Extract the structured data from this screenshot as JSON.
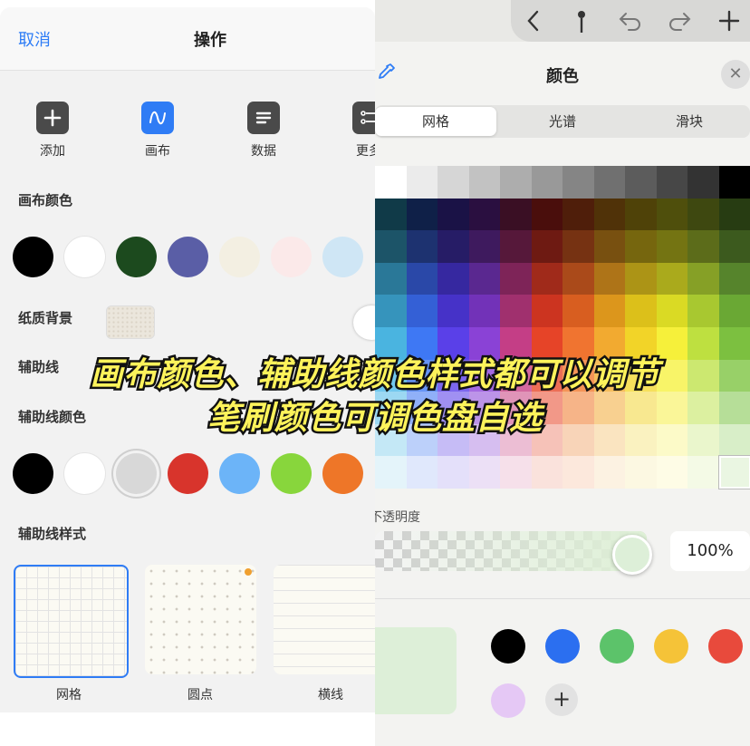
{
  "left_panel": {
    "cancel": "取消",
    "title": "操作",
    "tools": [
      {
        "label": "添加",
        "icon": "plus-icon"
      },
      {
        "label": "画布",
        "icon": "canvas-wave-icon"
      },
      {
        "label": "数据",
        "icon": "data-lines-icon"
      },
      {
        "label": "更多",
        "icon": "more-icon"
      }
    ],
    "canvas_color_title": "画布颜色",
    "canvas_colors": [
      "#000000",
      "#ffffff",
      "#1c4a1e",
      "#5a5ea6",
      "#f3efe2",
      "#fbe9e9",
      "#cfe6f5"
    ],
    "paper_bg_label": "纸质背景",
    "guide_label": "辅助线",
    "guide_color_title": "辅助线颜色",
    "guide_colors": [
      "#000000",
      "#ffffff",
      "#d8d8d8",
      "#d8342c",
      "#6cb4f8",
      "#88d63c",
      "#ee7628"
    ],
    "guide_style_title": "辅助线样式",
    "styles": [
      "网格",
      "圆点",
      "横线"
    ]
  },
  "right_panel": {
    "top_icons": [
      "back-chevron-icon",
      "pin-icon",
      "undo-icon",
      "redo-icon",
      "plus-icon"
    ],
    "title": "颜色",
    "close": "✕",
    "tabs": [
      "网格",
      "光谱",
      "滑块"
    ],
    "active_tab": 0,
    "opacity_label": "不透明度",
    "opacity_value": "100%",
    "opacity_fraction": 1.0,
    "current_color": "#ddefd8",
    "recent_colors": [
      "#000000",
      "#2b6ff0",
      "#5cc36a",
      "#f5c338",
      "#e84a3c",
      "#e5c8f5"
    ],
    "add_label": "+"
  },
  "caption": {
    "line1": "画布颜色、辅助线颜色样式都可以调节",
    "line2": "笔刷颜色可调色盘自选"
  },
  "palette": {
    "rows": [
      [
        "#ffffff",
        "#ebebeb",
        "#d6d6d6",
        "#c2c2c2",
        "#adadad",
        "#999999",
        "#858585",
        "#707070",
        "#5c5c5c",
        "#474747",
        "#333333",
        "#000000"
      ],
      [
        "#103a48",
        "#0f2048",
        "#1a1246",
        "#2a0f40",
        "#3a0f24",
        "#4a0e0c",
        "#4f1e0a",
        "#503208",
        "#4f4208",
        "#4f4f0c",
        "#3e4810",
        "#273c12"
      ],
      [
        "#1c5468",
        "#1d3270",
        "#261c66",
        "#3e1a5e",
        "#56183a",
        "#6e1a12",
        "#763212",
        "#785010",
        "#76660e",
        "#747412",
        "#5c6c1a",
        "#3c5a1e"
      ],
      [
        "#2a7898",
        "#2a48a8",
        "#3628a0",
        "#5a2890",
        "#7e2458",
        "#a02a1a",
        "#aa4a1a",
        "#ae7418",
        "#ac9416",
        "#aaaa1c",
        "#86a026",
        "#56842c"
      ],
      [
        "#3694bc",
        "#3460d6",
        "#4632c8",
        "#7232b8",
        "#a0306e",
        "#cc3420",
        "#d85e20",
        "#dc961c",
        "#dcc01a",
        "#dada24",
        "#a8c830",
        "#6aa834"
      ],
      [
        "#4ab4e0",
        "#3e78f4",
        "#5a40e8",
        "#8a42d6",
        "#c43e86",
        "#e64428",
        "#f07430",
        "#f2aa30",
        "#f2d428",
        "#f6f03a",
        "#bee040",
        "#7cc040"
      ],
      [
        "#72c8ee",
        "#6694f6",
        "#7c66ee",
        "#a46ae2",
        "#d4689e",
        "#ec6e56",
        "#f49458",
        "#f6be5c",
        "#f6e05c",
        "#f8f468",
        "#cce870",
        "#98d068"
      ],
      [
        "#9cd8f2",
        "#90b0f8",
        "#a090f2",
        "#bc94e8",
        "#e094b8",
        "#f29888",
        "#f6b488",
        "#f8d090",
        "#f8e890",
        "#faf698",
        "#dcf0a0",
        "#b6de98"
      ],
      [
        "#c4e8f6",
        "#bcd0fa",
        "#c6bcf6",
        "#d6bef0",
        "#ecbed4",
        "#f6c2b8",
        "#f8d4b8",
        "#fae4c0",
        "#faf2c0",
        "#fcfac8",
        "#eaf6cc",
        "#d8eec8"
      ],
      [
        "#e4f4fa",
        "#e0e8fc",
        "#e4e0fa",
        "#ece0f6",
        "#f6e0ea",
        "#fae2dc",
        "#fce8dc",
        "#fcf2e2",
        "#fcf8e2",
        "#fefce6",
        "#f4fae6",
        "#eaf6e2"
      ]
    ],
    "selected": [
      9,
      11
    ]
  }
}
